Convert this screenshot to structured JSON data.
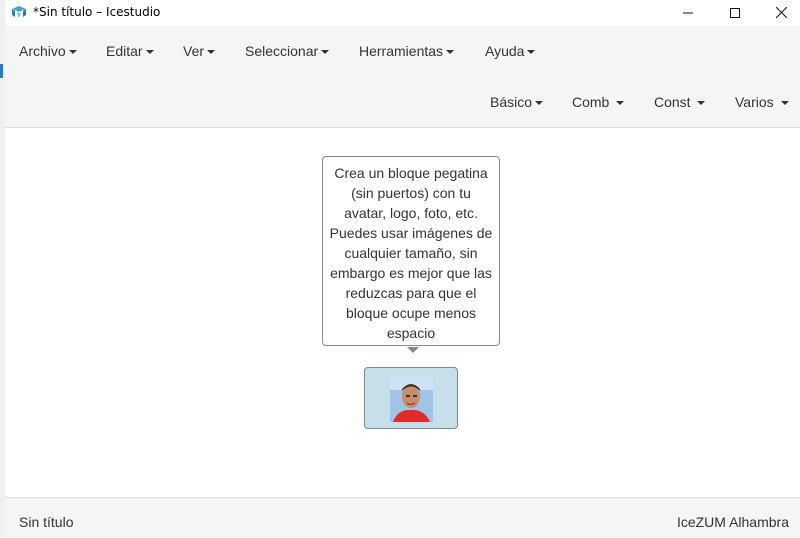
{
  "window": {
    "title": "*Sin título – Icestudio"
  },
  "menu": {
    "items": [
      {
        "label": "Archivo"
      },
      {
        "label": "Editar"
      },
      {
        "label": "Ver"
      },
      {
        "label": "Seleccionar"
      },
      {
        "label": "Herramientas"
      },
      {
        "label": "Ayuda"
      }
    ]
  },
  "blocks_menu": {
    "items": [
      {
        "label": "Básico"
      },
      {
        "label": "Comb"
      },
      {
        "label": "Const"
      },
      {
        "label": "Varios"
      }
    ]
  },
  "canvas": {
    "tooltip_lines": [
      "Crea un bloque pegatina",
      "(sin puertos) con tu",
      "avatar, logo, foto, etc.",
      "Puedes usar imágenes de",
      "cualquier tamaño, sin",
      "embargo es mejor que las",
      "reduzcas para que el",
      "bloque ocupe menos",
      "espacio"
    ],
    "block_icon": "avatar-photo"
  },
  "footer": {
    "project_name": "Sin título",
    "board": "IceZUM Alhambra"
  },
  "colors": {
    "block_bg": "#c6dfe8",
    "bar_bg": "#f5f5f5"
  }
}
